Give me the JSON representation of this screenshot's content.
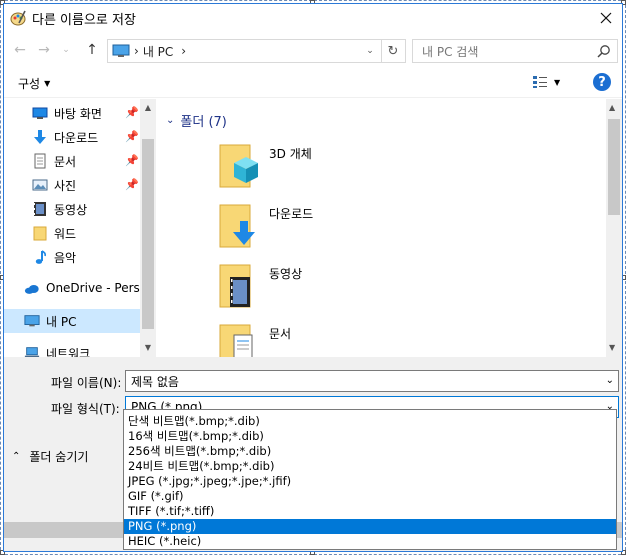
{
  "window": {
    "title": "다른 이름으로 저장",
    "close_icon": "close-icon"
  },
  "nav": {
    "path_segments": [
      "내 PC"
    ],
    "search_placeholder": "내 PC 검색"
  },
  "toolbar": {
    "organize_label": "구성",
    "help_label": "?"
  },
  "navpane": {
    "items": [
      {
        "label": "바탕 화면",
        "icon": "desktop-icon",
        "pinned": true
      },
      {
        "label": "다운로드",
        "icon": "download-icon",
        "pinned": true
      },
      {
        "label": "문서",
        "icon": "document-icon",
        "pinned": true
      },
      {
        "label": "사진",
        "icon": "picture-icon",
        "pinned": true
      },
      {
        "label": "동영상",
        "icon": "video-icon",
        "pinned": false
      },
      {
        "label": "워드",
        "icon": "folder-icon",
        "pinned": false
      },
      {
        "label": "음악",
        "icon": "music-icon",
        "pinned": false
      },
      {
        "label": "OneDrive - Person",
        "icon": "cloud-icon",
        "pinned": false
      },
      {
        "label": "내 PC",
        "icon": "computer-icon",
        "pinned": false,
        "selected": true
      },
      {
        "label": "네트워크",
        "icon": "network-icon",
        "pinned": false
      }
    ]
  },
  "content": {
    "group_header": "폴더 (7)",
    "folders": [
      {
        "name": "3D 개체",
        "icon": "3d-objects-folder-icon"
      },
      {
        "name": "다운로드",
        "icon": "downloads-folder-icon"
      },
      {
        "name": "동영상",
        "icon": "videos-folder-icon"
      },
      {
        "name": "문서",
        "icon": "documents-folder-icon"
      }
    ]
  },
  "form": {
    "filename_label": "파일 이름(N):",
    "filename_value": "제목 없음",
    "filetype_label": "파일 형식(T):",
    "filetype_value": "PNG (*.png)",
    "hide_folders_label": "폴더 숨기기"
  },
  "filetype_options": [
    {
      "label": "단색 비트맵(*.bmp;*.dib)",
      "selected": false
    },
    {
      "label": "16색 비트맵(*.bmp;*.dib)",
      "selected": false
    },
    {
      "label": "256색 비트맵(*.bmp;*.dib)",
      "selected": false
    },
    {
      "label": "24비트 비트맵(*.bmp;*.dib)",
      "selected": false
    },
    {
      "label": "JPEG (*.jpg;*.jpeg;*.jpe;*.jfif)",
      "selected": false
    },
    {
      "label": "GIF (*.gif)",
      "selected": false
    },
    {
      "label": "TIFF (*.tif;*.tiff)",
      "selected": false
    },
    {
      "label": "PNG (*.png)",
      "selected": true
    },
    {
      "label": "HEIC (*.heic)",
      "selected": false
    }
  ],
  "colors": {
    "accent": "#0078d7",
    "selection_bg": "#cce8ff",
    "group_header": "#1e3287",
    "folder_yellow": "#f8d775"
  }
}
